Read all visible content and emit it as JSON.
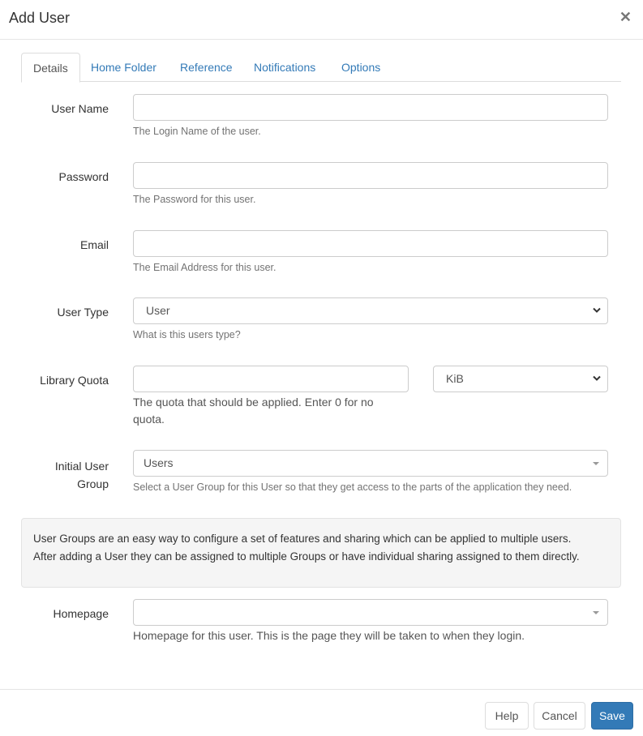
{
  "dialog": {
    "title": "Add User",
    "close_icon": "close-icon"
  },
  "tabs": [
    {
      "label": "Details",
      "active": true
    },
    {
      "label": "Home Folder",
      "active": false
    },
    {
      "label": "Reference",
      "active": false
    },
    {
      "label": "Notifications",
      "active": false
    },
    {
      "label": "Options",
      "active": false
    }
  ],
  "form": {
    "user_name": {
      "label": "User Name",
      "value": "",
      "help": "The Login Name of the user."
    },
    "password": {
      "label": "Password",
      "value": "",
      "help": "The Password for this user."
    },
    "email": {
      "label": "Email",
      "value": "",
      "help": "The Email Address for this user."
    },
    "user_type": {
      "label": "User Type",
      "selected": "User",
      "help": "What is this users type?"
    },
    "library_quota": {
      "label": "Library Quota",
      "value": "",
      "unit_selected": "KiB",
      "help": "The quota that should be applied. Enter 0 for no quota."
    },
    "initial_user_group": {
      "label_line1": "Initial User",
      "label_line2": "Group",
      "selected": "Users",
      "help": "Select a User Group for this User so that they get access to the parts of the application they need."
    },
    "homepage": {
      "label": "Homepage",
      "selected": "",
      "help": "Homepage for this user. This is the page they will be taken to when they login."
    }
  },
  "info": {
    "line1": "User Groups are an easy way to configure a set of features and sharing which can be applied to multiple users.",
    "line2": "After adding a User they can be assigned to multiple Groups or have individual sharing assigned to them directly."
  },
  "footer": {
    "help_label": "Help",
    "cancel_label": "Cancel",
    "save_label": "Save"
  },
  "colors": {
    "primary": "#337ab7",
    "link": "#337ab7",
    "border": "#cccccc",
    "well_bg": "#f5f5f5"
  }
}
